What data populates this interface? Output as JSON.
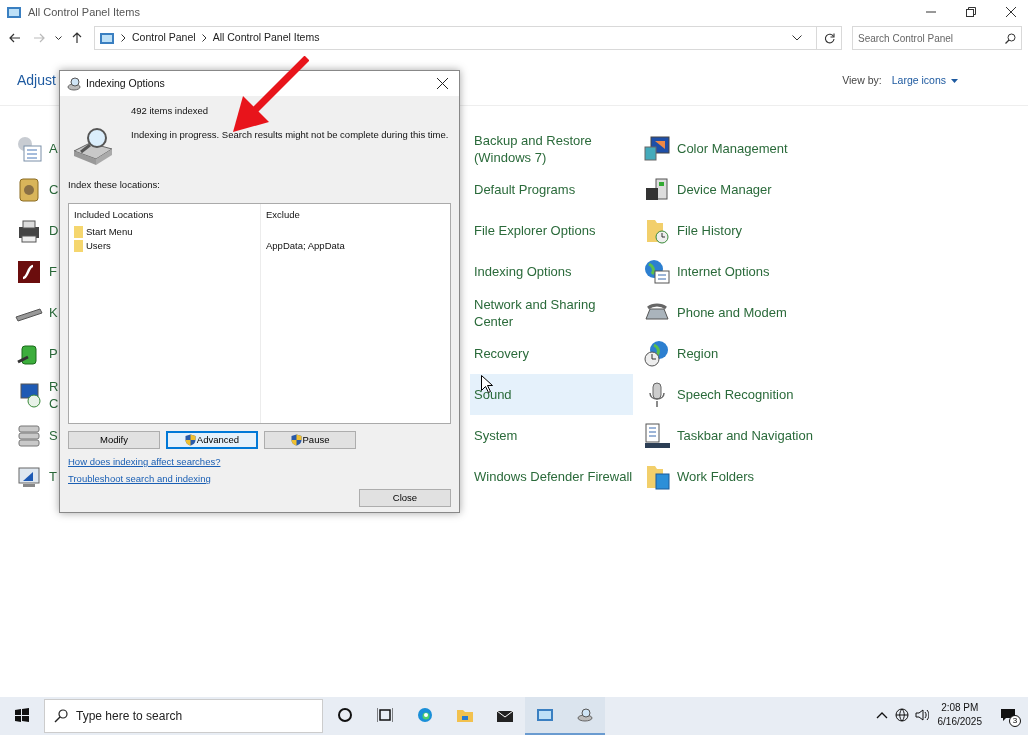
{
  "window": {
    "title": "All Control Panel Items"
  },
  "address": {
    "breadcrumb": [
      "Control Panel",
      "All Control Panel Items"
    ],
    "search": {
      "placeholder": "Search Control Panel"
    }
  },
  "header": {
    "title": "Adjust",
    "view_by_label": "View by:",
    "view_by_value": "Large icons"
  },
  "items": {
    "column_1": [
      {
        "label": "A",
        "highlighted": false
      },
      {
        "label": "C",
        "highlighted": false
      },
      {
        "label": "D",
        "highlighted": false
      },
      {
        "label": "F",
        "highlighted": false
      },
      {
        "label": "K",
        "highlighted": false
      },
      {
        "label": "P",
        "highlighted": false
      },
      {
        "label": "R C",
        "highlighted": false
      },
      {
        "label": "S",
        "highlighted": false
      },
      {
        "label": "T",
        "highlighted": false
      }
    ],
    "column_2": [
      {
        "label": "Backup and Restore (Windows 7)",
        "highlighted": false
      },
      {
        "label": "Default Programs",
        "highlighted": false
      },
      {
        "label": "File Explorer Options",
        "highlighted": false
      },
      {
        "label": "Indexing Options",
        "highlighted": false
      },
      {
        "label": "Network and Sharing Center",
        "highlighted": false
      },
      {
        "label": "Recovery",
        "highlighted": false
      },
      {
        "label": "Sound",
        "highlighted": true
      },
      {
        "label": "System",
        "highlighted": false
      },
      {
        "label": "Windows Defender Firewall",
        "highlighted": false
      }
    ],
    "column_3": [
      {
        "label": "Color Management",
        "highlighted": false
      },
      {
        "label": "Device Manager",
        "highlighted": false
      },
      {
        "label": "File History",
        "highlighted": false
      },
      {
        "label": "Internet Options",
        "highlighted": false
      },
      {
        "label": "Phone and Modem",
        "highlighted": false
      },
      {
        "label": "Region",
        "highlighted": false
      },
      {
        "label": "Speech Recognition",
        "highlighted": false
      },
      {
        "label": "Taskbar and Navigation",
        "highlighted": false
      },
      {
        "label": "Work Folders",
        "highlighted": false
      }
    ]
  },
  "dialog": {
    "title": "Indexing Options",
    "count": "492 items indexed",
    "status": "Indexing in progress. Search results might not be complete during this time.",
    "locations_label": "Index these locations:",
    "table": {
      "columns": [
        "Included Locations",
        "Exclude"
      ],
      "rows": [
        {
          "location": "Start Menu"
        },
        {
          "location": "Users",
          "exclude": "AppData; AppData"
        }
      ]
    },
    "buttons": [
      {
        "label": "Modify",
        "shield": false,
        "focused": false
      },
      {
        "label": "Advanced",
        "shield": true,
        "focused": true
      },
      {
        "label": "Pause",
        "shield": true,
        "focused": false
      }
    ],
    "links": [
      "How does indexing affect searches?",
      "Troubleshoot search and indexing"
    ],
    "close_button": "Close"
  },
  "taskbar": {
    "search": {
      "placeholder": "Type here to search"
    },
    "apps": [
      {
        "kind": "cortana",
        "running": false
      },
      {
        "kind": "taskview",
        "running": false
      },
      {
        "kind": "edge",
        "running": false
      },
      {
        "kind": "explorer",
        "running": false
      },
      {
        "kind": "mail",
        "running": false
      },
      {
        "kind": "controlpanel",
        "running": true
      },
      {
        "kind": "indexing",
        "running": true
      }
    ],
    "time": "2:08 PM",
    "date": "6/16/2025",
    "notifications": "3"
  }
}
